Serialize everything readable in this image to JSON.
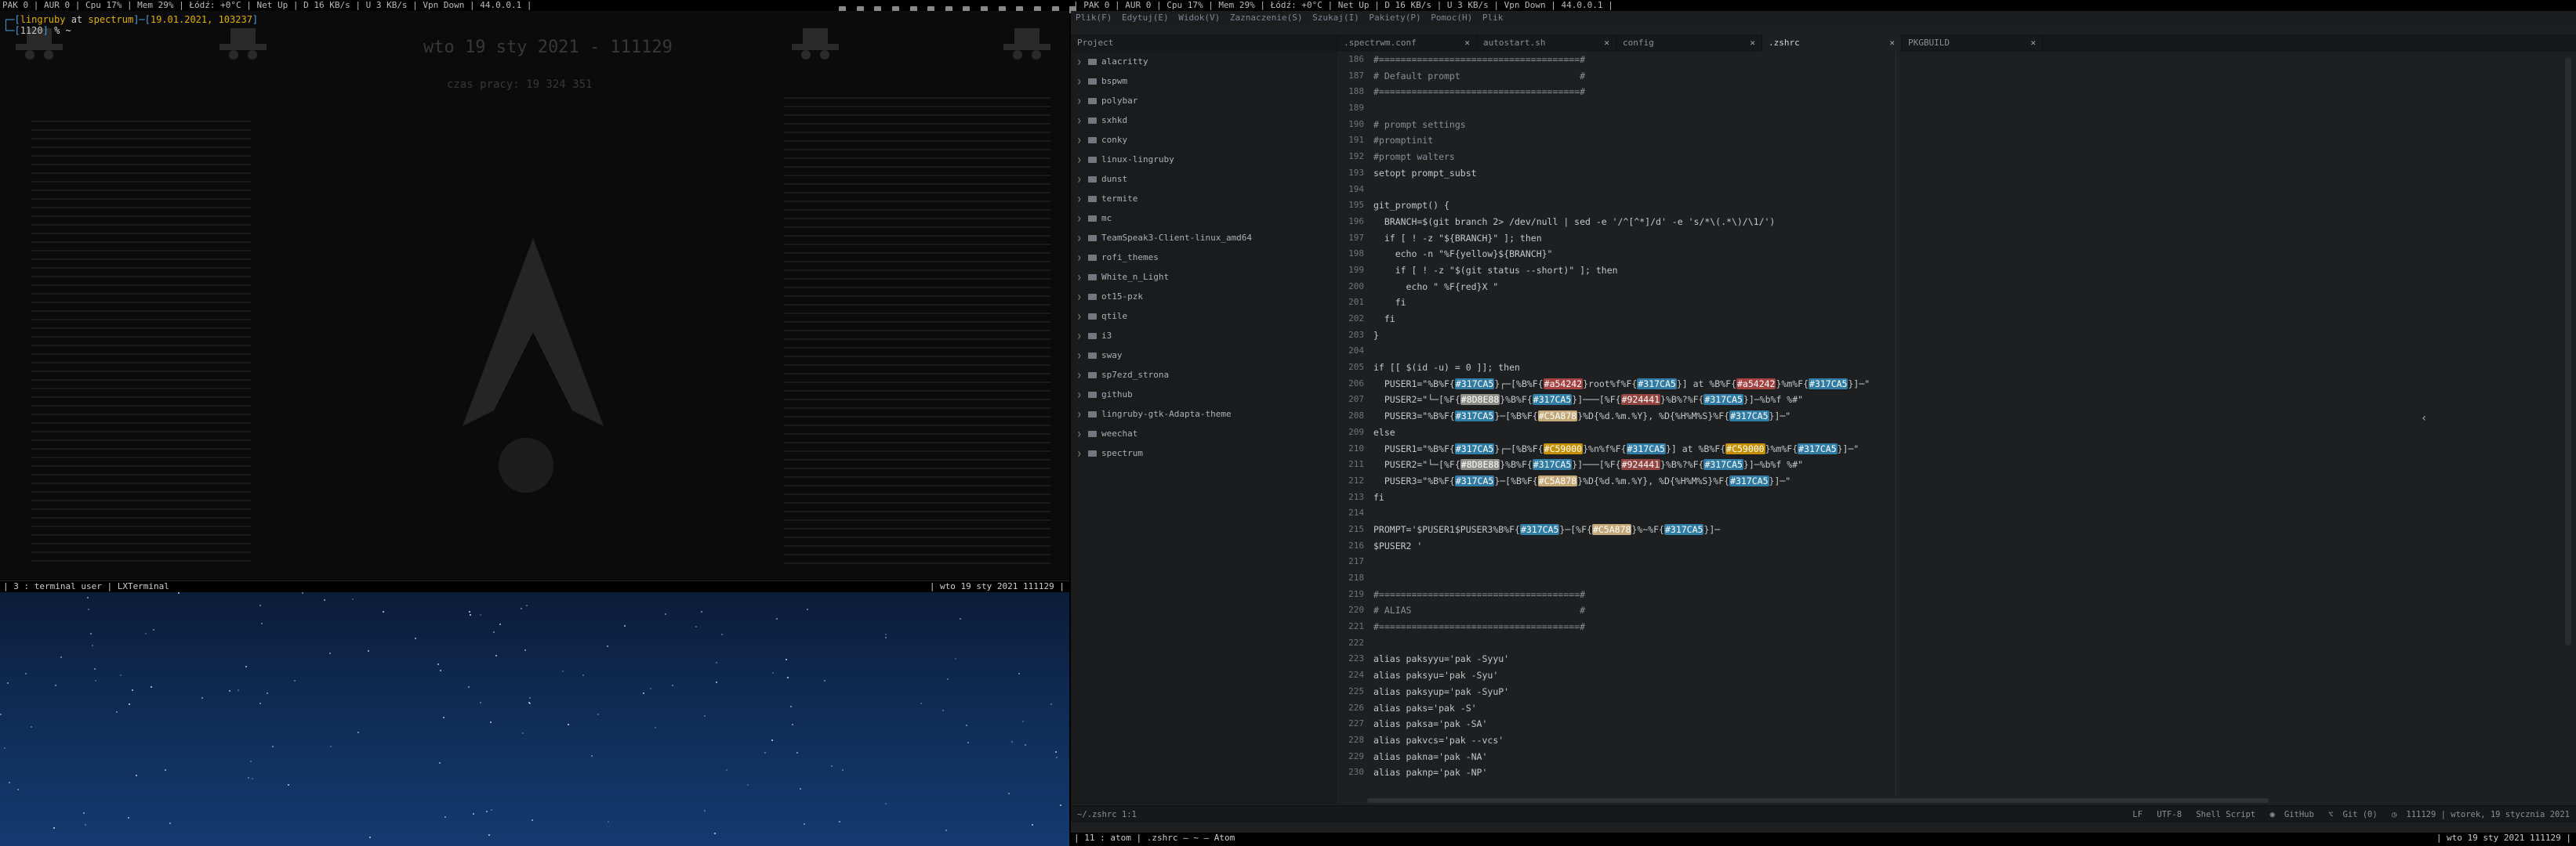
{
  "left_bar": {
    "text": "PAK  0 | AUR  0 | Cpu  17% | Mem  29% | Łódź:  +0°C | Net  Up | D  16 KB/s | U  3 KB/s | Vpn  Down | 44.0.0.1 |"
  },
  "right_bar": {
    "text": "| PAK  0 | AUR  0 | Cpu  17% | Mem  29% | Łódź:  +0°C | Net  Up | D  16 KB/s | U  3 KB/s | Vpn  Down | 44.0.0.1 |"
  },
  "terminal": {
    "user": "lingruby",
    "at": " at ",
    "host": "spectrum",
    "date": "19.01.2021, 103237",
    "line2": "1120",
    "cwd": "% ~",
    "ghost_title": "wto 19 sty 2021 - 111129",
    "ghost_subtitle": "czas pracy: 19 324 351"
  },
  "left_status": {
    "left": "| 3 : terminal user | LXTerminal",
    "right": "| wto 19 sty 2021  111129 |"
  },
  "atom": {
    "menu": [
      "Plik(F)",
      "Edytuj(E)",
      "Widok(V)",
      "Zaznaczenie(S)",
      "Szukaj(I)",
      "Pakiety(P)",
      "Pomoc(H)",
      "Plik"
    ],
    "tabs": [
      {
        "label": "Project",
        "active": false
      },
      {
        "label": ".spectrwm.conf",
        "active": false
      },
      {
        "label": "autostart.sh",
        "active": false
      },
      {
        "label": "config",
        "active": false
      },
      {
        "label": ".zshrc",
        "active": true
      },
      {
        "label": "PKGBUILD",
        "active": false
      }
    ],
    "tree": [
      "alacritty",
      "bspwm",
      "polybar",
      "sxhkd",
      "conky",
      "linux-lingruby",
      "dunst",
      "termite",
      "mc",
      "TeamSpeak3-Client-linux_amd64",
      "rofi_themes",
      "White_n_Light",
      "ot15-pzk",
      "qtile",
      "i3",
      "sway",
      "sp7ezd_strona",
      "github",
      "lingruby-gtk-Adapta-theme",
      "weechat",
      "spectrum"
    ],
    "line_numbers": [
      "186",
      "187",
      "188",
      "189",
      "190",
      "191",
      "192",
      "193",
      "194",
      "195",
      "196",
      "197",
      "198",
      "199",
      "200",
      "201",
      "202",
      "203",
      "204",
      "205",
      "206",
      "207",
      "208",
      "209",
      "210",
      "211",
      "212",
      "213",
      "214",
      "215",
      "216",
      "217",
      "218",
      "219",
      "220",
      "221",
      "222",
      "223",
      "224",
      "225",
      "226",
      "227",
      "228",
      "229",
      "230"
    ],
    "code": [
      "#=====================================#",
      "# Default prompt                      #",
      "#=====================================#",
      "",
      "# prompt settings",
      "#promptinit",
      "#prompt walters",
      "setopt prompt_subst",
      "",
      "git_prompt() {",
      "  BRANCH=$(git branch 2> /dev/null | sed -e '/^[^*]/d' -e 's/*\\(.*\\)/\\1/')",
      "  if [ ! -z \"${BRANCH}\" ]; then",
      "    echo -n \"%F{yellow}${BRANCH}\"",
      "    if [ ! -z \"$(git status --short)\" ]; then",
      "      echo \" %F{red}X \"",
      "    fi",
      "  fi",
      "}",
      "",
      "if [[ $(id -u) = 0 ]]; then",
      "  PUSER1=\"%B%F{#317CA5}┌─[%B%F{#a54242}root%f%F{#317CA5}] at %B%F{#a54242}%m%F{#317CA5}]─\"",
      "  PUSER2=\"└─[%F{#8D8E88}%B%F{#317CA5}]───[%F{#924441}%B%?%F{#317CA5}]─%b%f %#\"",
      "  PUSER3=\"%B%F{#317CA5}─[%B%F{#C5A878}%D{%d.%m.%Y}, %D{%H%M%S}%F{#317CA5}]─\"",
      "else",
      "  PUSER1=\"%B%F{#317CA5}┌─[%B%F{#C59000}%n%f%F{#317CA5}] at %B%F{#C59000}%m%F{#317CA5}]─\"",
      "  PUSER2=\"└─[%F{#8D8E88}%B%F{#317CA5}]───[%F{#924441}%B%?%F{#317CA5}]─%b%f %#\"",
      "  PUSER3=\"%B%F{#317CA5}─[%B%F{#C5A878}%D{%d.%m.%Y}, %D{%H%M%S}%F{#317CA5}]─\"",
      "fi",
      "",
      "PROMPT='$PUSER1$PUSER3%B%F{#317CA5}─[%F{#C5A878}%~%F{#317CA5}]─",
      "$PUSER2 '",
      "",
      "",
      "#=====================================#",
      "# ALIAS                               #",
      "#=====================================#",
      "",
      "alias paksyyu='pak -Syyu'",
      "alias paksyu='pak -Syu'",
      "alias paksyup='pak -SyuP'",
      "alias paks='pak -S'",
      "alias paksa='pak -SA'",
      "alias pakvcs='pak --vcs'",
      "alias pakna='pak -NA'",
      "alias paknp='pak -NP'"
    ],
    "status": {
      "file": "~/.zshrc  1:1",
      "items": [
        "LF",
        "UTF-8",
        "Shell Script",
        "GitHub",
        "Git (0)",
        "111129 | wtorek, 19 stycznia 2021"
      ]
    }
  },
  "right_status": {
    "left": "| 11 : atom | .zshrc — ~ — Atom",
    "right": "| wto 19 sty 2021  111129 |"
  },
  "colors": {
    "blue": "#317CA5",
    "red": "#a54242",
    "gold": "#C59000",
    "tan": "#C5A878",
    "grey": "#8D8E88",
    "darkred": "#924441"
  }
}
